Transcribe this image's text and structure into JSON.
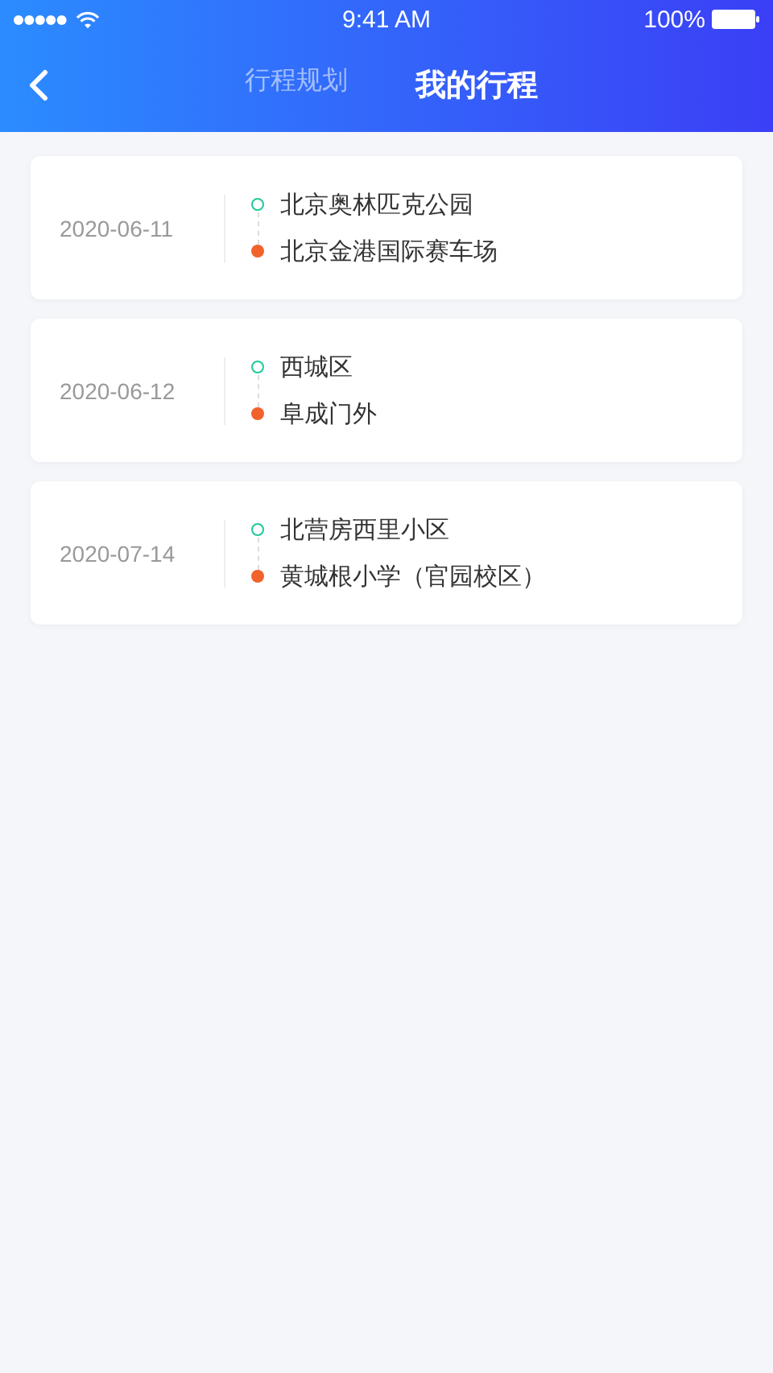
{
  "status_bar": {
    "time": "9:41 AM",
    "battery": "100%"
  },
  "tabs": [
    {
      "label": "行程规划",
      "selected": false
    },
    {
      "label": "我的行程",
      "selected": true
    }
  ],
  "trips": [
    {
      "date": "2020-06-11",
      "stops": [
        {
          "kind": "start",
          "name": "北京奥林匹克公园"
        },
        {
          "kind": "end",
          "name": "北京金港国际赛车场"
        }
      ]
    },
    {
      "date": "2020-06-12",
      "stops": [
        {
          "kind": "start",
          "name": "西城区"
        },
        {
          "kind": "end",
          "name": "阜成门外"
        }
      ]
    },
    {
      "date": "2020-07-14",
      "stops": [
        {
          "kind": "start",
          "name": "北营房西里小区"
        },
        {
          "kind": "end",
          "name": "黄城根小学（官园校区）"
        }
      ]
    }
  ]
}
